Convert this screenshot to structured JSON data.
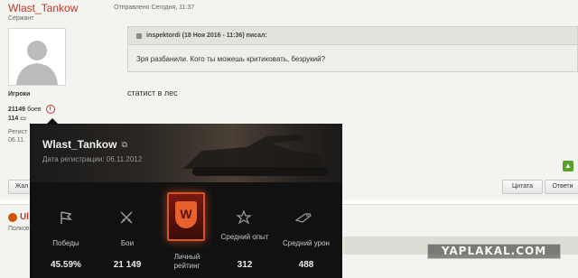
{
  "post": {
    "username": "Wlast_Tankow",
    "rank": "Сержант",
    "group": "Игроки",
    "battles_count": "21149",
    "battles_label": "боев",
    "info_glyph": "i",
    "posts_count": "114",
    "reg_label": "Регист",
    "reg_date": "06.11.",
    "sent_text": "Отправлено Сегодня, 11:37",
    "quote_header": "inspektordi (18 Ноя 2016 - 11:36) писал:",
    "quote_text": "Зря разбанили. Кого ты можешь критиковать, безрукий?",
    "message": "статист в лес",
    "up_glyph": "▲",
    "btn_left": "Жал",
    "btn_cite": "Цитата",
    "btn_reply": "Ответи"
  },
  "next_post": {
    "name": "Ul",
    "rank": "Полков"
  },
  "card": {
    "name": "Wlast_Tankow",
    "ext_glyph": "⧉",
    "reg_text": "Дата регистрации: 06.11.2012",
    "stats": [
      {
        "label": "Победы",
        "value": "45.59%",
        "icon": "flag-icon"
      },
      {
        "label": "Бои",
        "value": "21 149",
        "icon": "crossed-swords-icon"
      },
      {
        "label": "Личный рейтинг",
        "value": "",
        "icon": "rating-badge-icon"
      },
      {
        "label": "Средний опыт",
        "value": "312",
        "icon": "star-icon"
      },
      {
        "label": "Средний урон",
        "value": "488",
        "icon": "shell-icon"
      }
    ],
    "badge_letter": "W",
    "accent_color": "#e8602c"
  },
  "watermark": "YAPLAKAL.COM",
  "colors": {
    "username": "#c0392b",
    "card_bg": "#111111"
  }
}
